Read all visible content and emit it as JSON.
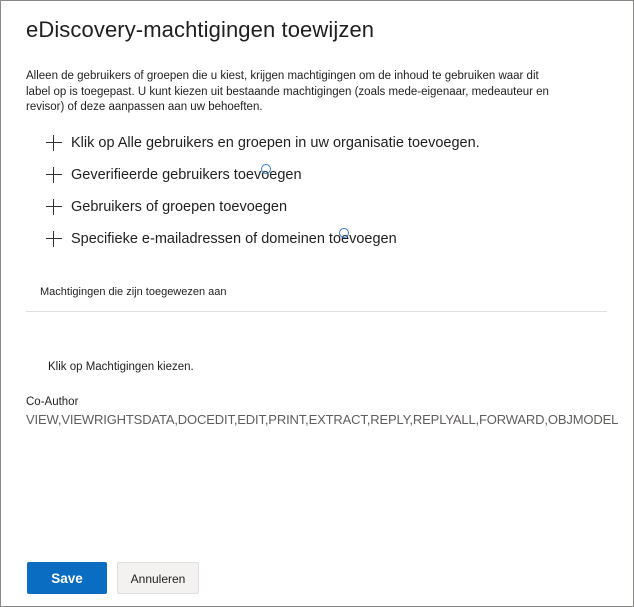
{
  "panel": {
    "title": "eDiscovery-machtigingen toewijzen",
    "description": "Alleen de gebruikers of groepen die u kiest, krijgen machtigingen om de inhoud te gebruiken waar dit label op is toegepast. U kunt kiezen uit bestaande machtigingen (zoals mede-eigenaar, medeauteur en revisor) of deze aanpassen aan uw behoeften."
  },
  "actions": [
    {
      "label": "Klik op Alle gebruikers en groepen in uw organisatie toevoegen.",
      "icon": "plus-icon"
    },
    {
      "label": "Geverifieerde gebruikers toevoegen",
      "icon": "plus-icon"
    },
    {
      "label": "Gebruikers of groepen toevoegen",
      "icon": "plus-icon"
    },
    {
      "label": "Specifieke e-mailadressen of domeinen toevoegen",
      "icon": "plus-icon"
    }
  ],
  "assigned": {
    "label": "Machtigingen die zijn toegewezen aan",
    "choose_link": "Klik op Machtigingen kiezen."
  },
  "permission": {
    "role": "Co-Author",
    "rights": "VIEW,VIEWRIGHTSDATA,DOCEDIT,EDIT,PRINT,EXTRACT,REPLY,REPLYALL,FORWARD,OBJMODEL"
  },
  "footer": {
    "save_label": "Save",
    "cancel_label": "Annuleren"
  },
  "colors": {
    "primary_button": "#0a6dc2",
    "secondary_button": "#f3f2f1",
    "text": "#201f1e",
    "muted_text": "#605e5c"
  }
}
